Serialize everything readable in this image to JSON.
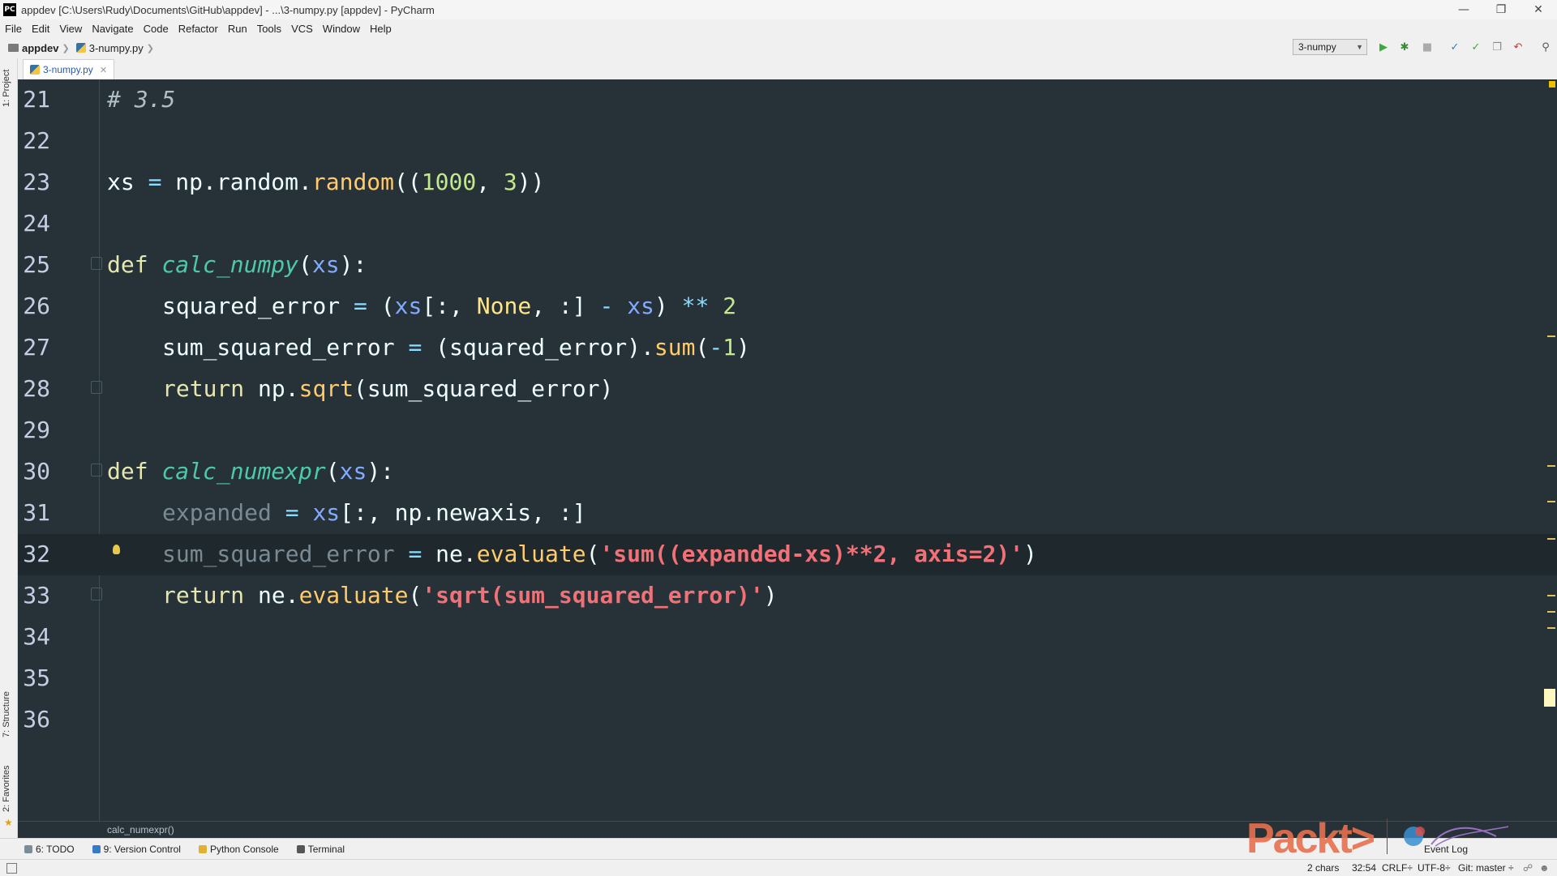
{
  "window": {
    "title": "appdev [C:\\Users\\Rudy\\Documents\\GitHub\\appdev] - ...\\3-numpy.py [appdev] - PyCharm",
    "app_icon": "PC"
  },
  "menu": [
    "File",
    "Edit",
    "View",
    "Navigate",
    "Code",
    "Refactor",
    "Run",
    "Tools",
    "VCS",
    "Window",
    "Help"
  ],
  "navbar": {
    "project": "appdev",
    "file": "3-numpy.py",
    "run_config": "3-numpy"
  },
  "left_strip": {
    "project": "1: Project",
    "structure": "7: Structure",
    "favorites": "2: Favorites"
  },
  "tabs": [
    {
      "label": "3-numpy.py",
      "active": true
    }
  ],
  "editor": {
    "current_line": 32,
    "lines": [
      {
        "n": "21"
      },
      {
        "n": "22"
      },
      {
        "n": "23"
      },
      {
        "n": "24"
      },
      {
        "n": "25"
      },
      {
        "n": "26"
      },
      {
        "n": "27"
      },
      {
        "n": "28"
      },
      {
        "n": "29"
      },
      {
        "n": "30"
      },
      {
        "n": "31"
      },
      {
        "n": "32"
      },
      {
        "n": "33"
      },
      {
        "n": "34"
      },
      {
        "n": "35"
      },
      {
        "n": "36"
      }
    ],
    "code": {
      "l21": "# 3.5",
      "l23": "xs = np.random.random((1000, 3))",
      "l25": "def calc_numpy(xs):",
      "l26": "squared_error = (xs[:, None, :] - xs) ** 2",
      "l27": "sum_squared_error = (squared_error).sum(-1)",
      "l28": "return np.sqrt(sum_squared_error)",
      "l30": "def calc_numexpr(xs):",
      "l31": "expanded = xs[:, np.newaxis, :]",
      "l32": "sum_squared_error = ne.evaluate('sum((expanded-xs)**2, axis=2)')",
      "l33": "return ne.evaluate('sqrt(sum_squared_error)')"
    },
    "breadcrumb": "calc_numexpr()"
  },
  "tool_windows": [
    {
      "label": "6: TODO"
    },
    {
      "label": "9: Version Control"
    },
    {
      "label": "Python Console"
    },
    {
      "label": "Terminal"
    }
  ],
  "event_log": "Event Log",
  "status": {
    "selection": "2 chars",
    "position": "32:54",
    "line_sep": "CRLF÷",
    "encoding": "UTF-8÷",
    "vcs": "Git: master ÷"
  },
  "watermark": {
    "brand": "Packt>"
  },
  "colors": {
    "editor_bg": "#263238",
    "current_line": "#1f282d",
    "string": "#f07178",
    "function": "#4ec9a8",
    "call": "#ffcb6b",
    "number": "#c3e88d"
  }
}
